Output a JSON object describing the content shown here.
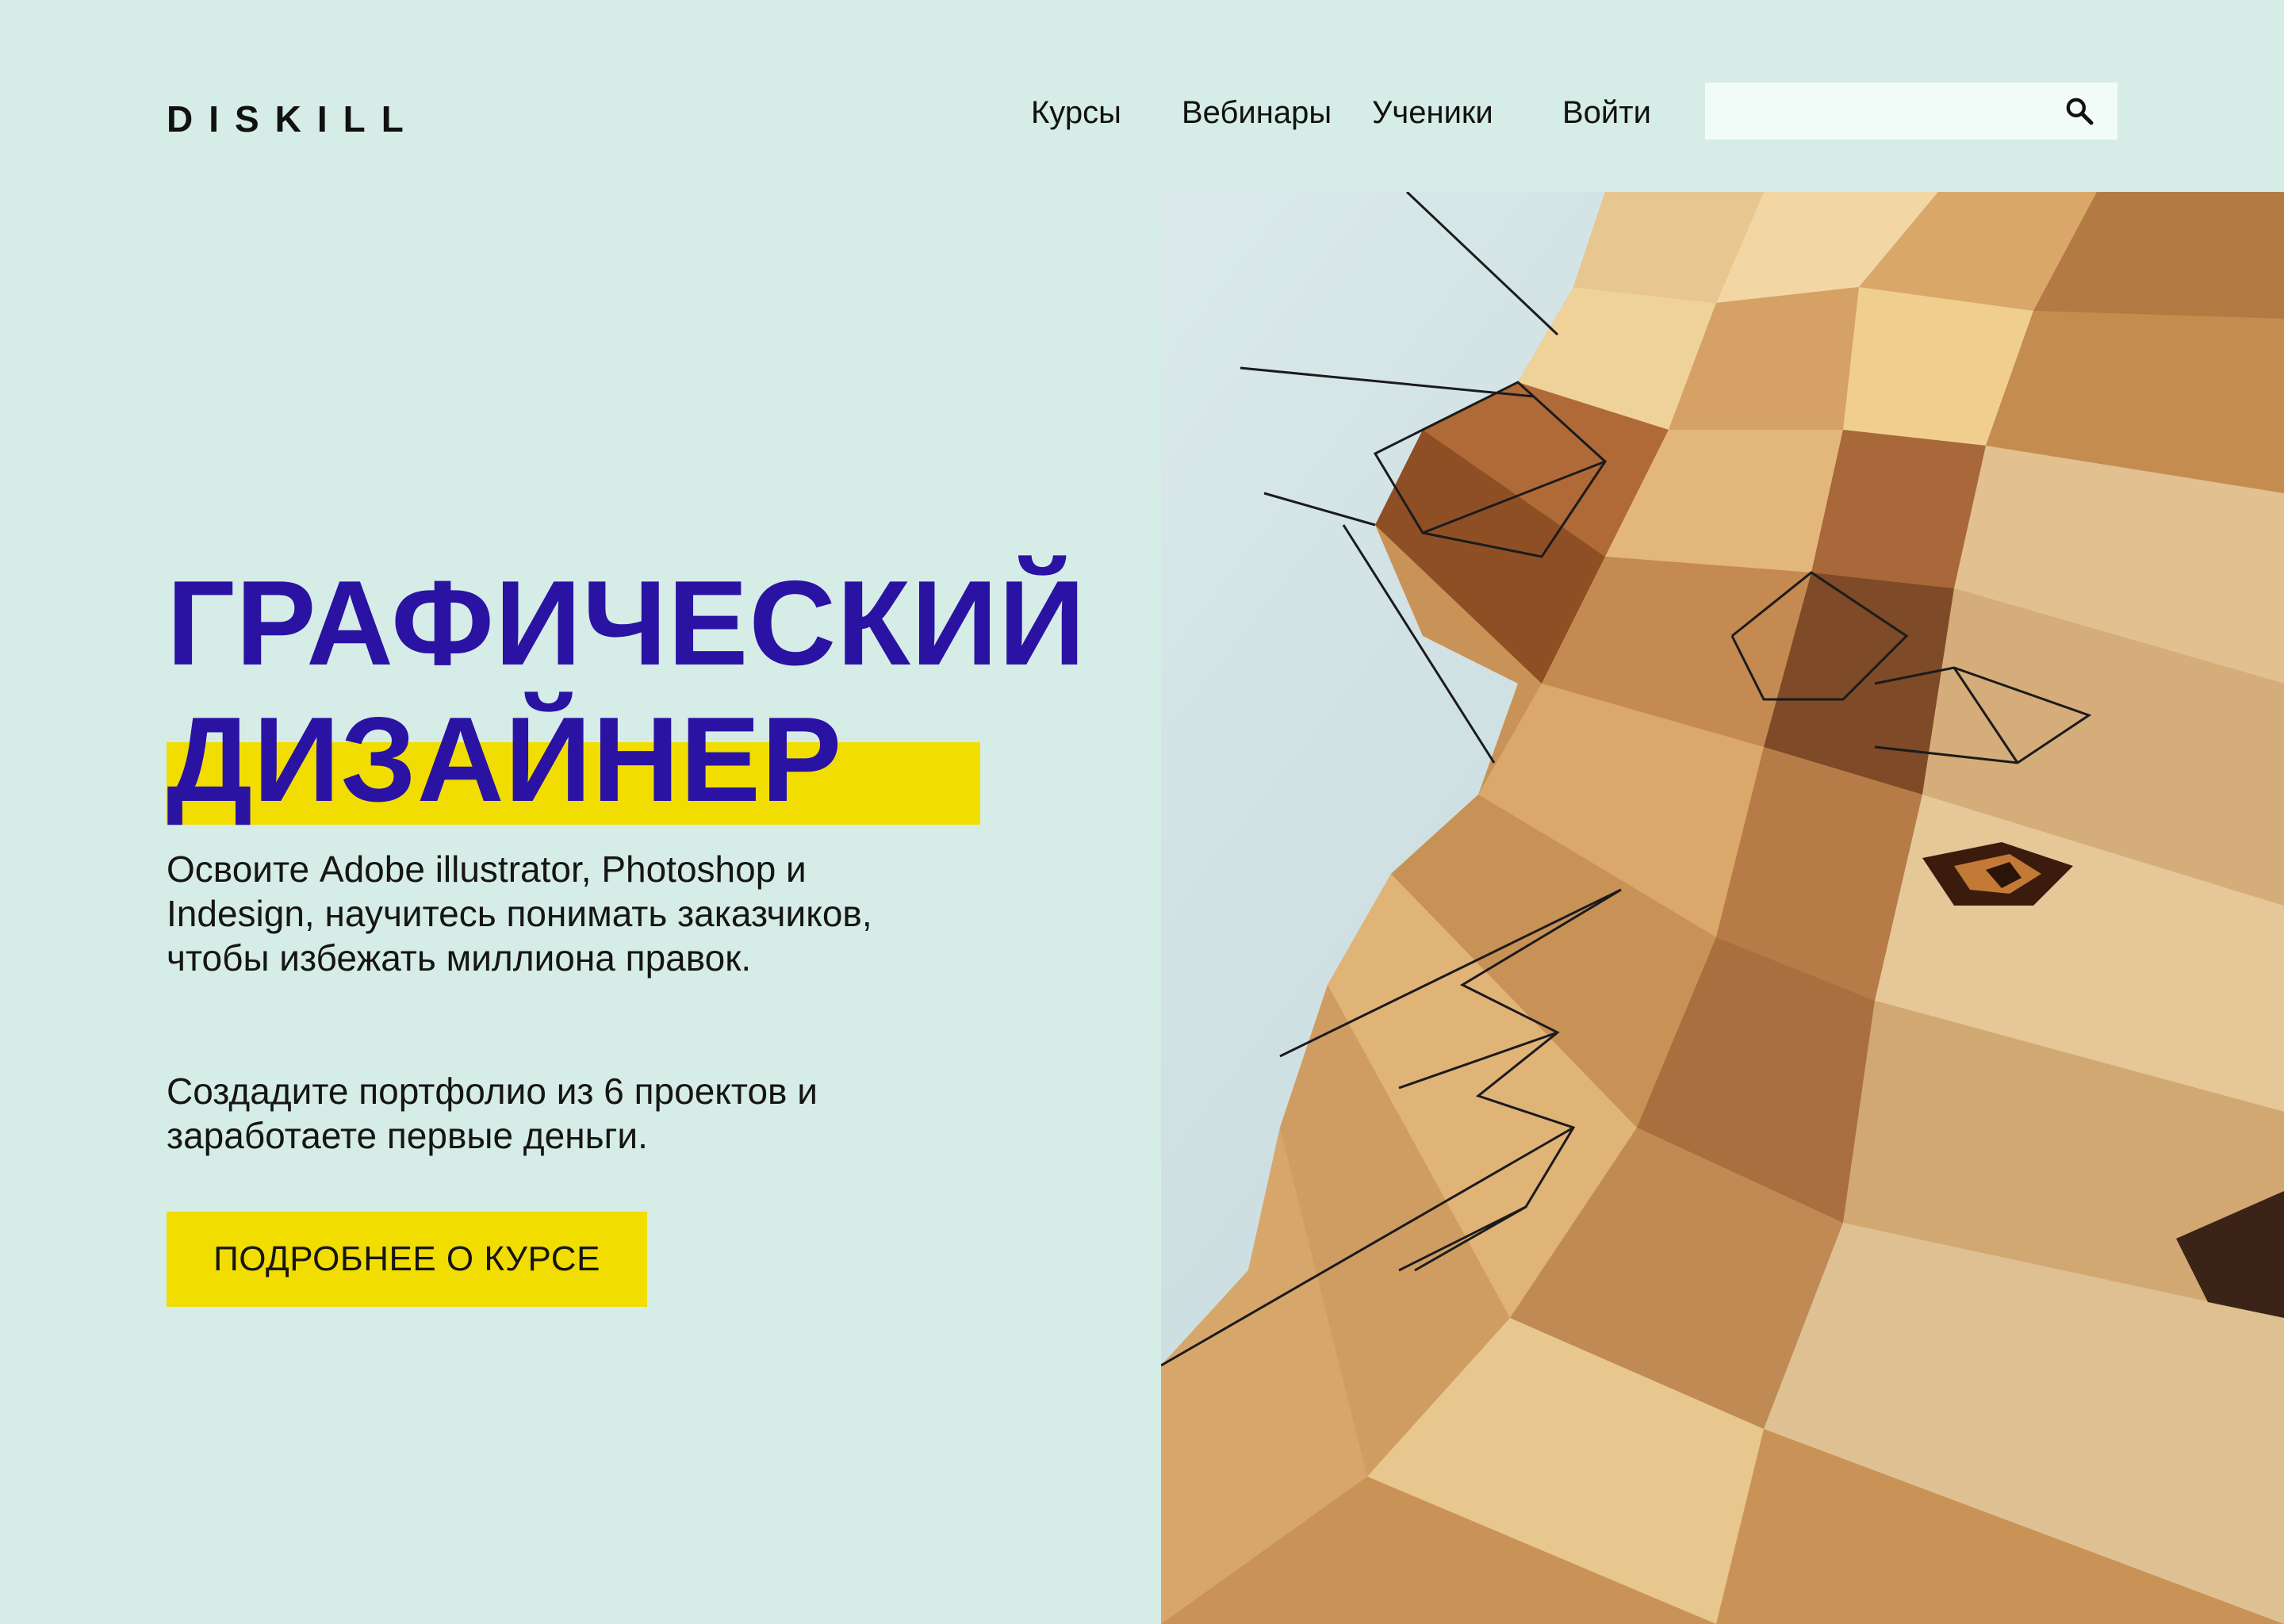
{
  "header": {
    "logo": "DISKILL",
    "nav": {
      "courses": "Курсы",
      "webinars": "Вебинары",
      "students": "Ученики",
      "login": "Войти"
    },
    "search": {
      "value": "",
      "placeholder": ""
    }
  },
  "hero": {
    "title_line1": "ГРАФИЧЕСКИЙ",
    "title_line2": "ДИЗАЙНЕР",
    "description_1": "Освоите Adobe illustrator, Photoshop и Indesign, научитесь понимать заказчиков, чтобы избежать миллиона правок.",
    "description_2": "Создадите портфолио из 6 проектов и заработаете первые деньги.",
    "cta_label": "ПОДРОБНЕЕ О КУРСЕ",
    "image": "low-poly lion illustration"
  },
  "colors": {
    "background": "#d6ece6",
    "title": "#2a13a3",
    "accent_yellow": "#f2dd00",
    "search_bg": "#f1fbf8",
    "text": "#151515"
  },
  "icons": {
    "search": "search-icon"
  }
}
